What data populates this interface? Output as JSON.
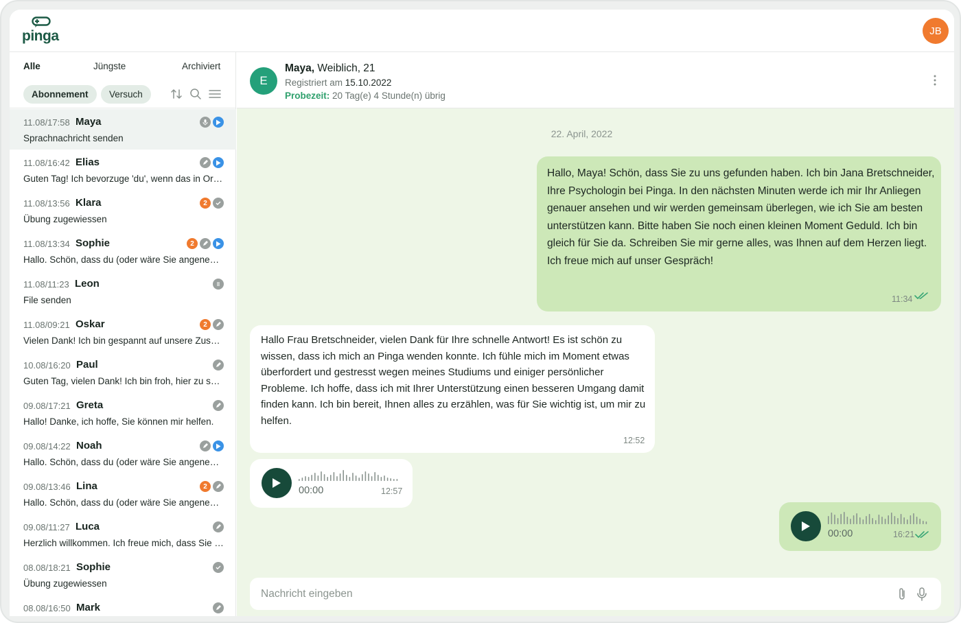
{
  "app": {
    "logo_text": "pinga",
    "user_initials": "JB"
  },
  "sidebar": {
    "tabs": [
      {
        "label": "Alle",
        "active": true
      },
      {
        "label": "Jüngste",
        "active": false
      },
      {
        "label": "Archiviert",
        "active": false
      }
    ],
    "filters": [
      {
        "label": "Abonnement",
        "selected": true
      },
      {
        "label": "Versuch",
        "selected": false
      }
    ],
    "filter_icons": [
      "sort-icon",
      "search-icon",
      "menu-icon"
    ],
    "conversations": [
      {
        "time": "11.08/17:58",
        "name": "Maya",
        "preview": "Sprachnachricht senden",
        "count": "",
        "icons": [
          "mic",
          "play"
        ],
        "selected": true
      },
      {
        "time": "11.08/16:42",
        "name": "Elias",
        "preview": "Guten Tag! Ich bevorzuge 'du', wenn das in Ordnung ist.",
        "count": "",
        "icons": [
          "pencil",
          "play"
        ],
        "selected": false
      },
      {
        "time": "11.08/13:56",
        "name": "Klara",
        "preview": "Übung zugewiessen",
        "count": "2",
        "icons": [
          "check"
        ],
        "selected": false
      },
      {
        "time": "11.08/13:34",
        "name": "Sophie",
        "preview": "Hallo. Schön, dass du (oder wäre Sie angenehmer?)",
        "count": "2",
        "icons": [
          "pencil",
          "play"
        ],
        "selected": false
      },
      {
        "time": "11.08/11:23",
        "name": "Leon",
        "preview": "File senden",
        "count": "",
        "icons": [
          "file"
        ],
        "selected": false
      },
      {
        "time": "11.08/09:21",
        "name": "Oskar",
        "preview": "Vielen Dank! Ich bin gespannt auf unsere Zusammenarbeit.",
        "count": "2",
        "icons": [
          "pencil"
        ],
        "selected": false
      },
      {
        "time": "10.08/16:20",
        "name": "Paul",
        "preview": "Guten Tag, vielen Dank! Ich bin froh, hier zu sein.",
        "count": "",
        "icons": [
          "pencil"
        ],
        "selected": false
      },
      {
        "time": "09.08/17:21",
        "name": "Greta",
        "preview": "Hallo! Danke, ich hoffe, Sie können mir helfen.",
        "count": "",
        "icons": [
          "pencil"
        ],
        "selected": false
      },
      {
        "time": "09.08/14:22",
        "name": "Noah",
        "preview": "Hallo. Schön, dass du (oder wäre Sie angenehmer?)",
        "count": "",
        "icons": [
          "pencil",
          "play"
        ],
        "selected": false
      },
      {
        "time": "09.08/13:46",
        "name": "Lina",
        "preview": "Hallo. Schön, dass du (oder wäre Sie angenehmer?)",
        "count": "2",
        "icons": [
          "pencil"
        ],
        "selected": false
      },
      {
        "time": "09.08/11:27",
        "name": "Luca",
        "preview": "Herzlich willkommen. Ich freue mich, dass Sie hier sind.",
        "count": "",
        "icons": [
          "pencil"
        ],
        "selected": false
      },
      {
        "time": "08.08/18:21",
        "name": "Sophie",
        "preview": "Übung zugewiessen",
        "count": "",
        "icons": [
          "check"
        ],
        "selected": false
      },
      {
        "time": "08.08/16:50",
        "name": "Mark",
        "preview": "",
        "count": "",
        "icons": [
          "pencil"
        ],
        "selected": false
      }
    ]
  },
  "chat": {
    "header": {
      "avatar_letter": "E",
      "name": "Maya,",
      "details": " Weiblich, 21",
      "registered_label": "Registriert am ",
      "registered_date": "15.10.2022",
      "trial_label": "Probezeit:",
      "trial_value": " 20 Tag(e) 4 Stunde(n) übrig"
    },
    "date_separator": "22. April, 2022",
    "messages": [
      {
        "direction": "out",
        "text": "Hallo, Maya! Schön, dass Sie zu uns gefunden haben. Ich bin Jana Bretschneider, Ihre Psychologin bei Pinga. In den nächsten Minuten werde ich mir Ihr Anliegen genauer ansehen und wir werden gemeinsam überlegen, wie ich Sie am besten unterstützen kann. Bitte haben Sie noch einen kleinen Moment Geduld. Ich bin gleich für Sie da. Schreiben Sie mir gerne alles, was Ihnen auf dem Herzen liegt. Ich freue mich auf unser Gespräch!",
        "time": "11:34"
      },
      {
        "direction": "in",
        "text": "Hallo Frau Bretschneider, vielen Dank für Ihre schnelle Antwort! Es ist schön zu wissen, dass ich mich an Pinga wenden konnte. Ich fühle mich im Moment etwas überfordert und gestresst wegen meines Studiums und einiger persönlicher Probleme. Ich hoffe, dass ich mit Ihrer Unterstützung einen besseren Umgang damit finden kann. Ich bin bereit, Ihnen alles zu erzählen, was für Sie wichtig ist, um mir zu helfen.",
        "time": "12:52"
      }
    ],
    "audio_in": {
      "position": "00:00",
      "time": "12:57"
    },
    "audio_out": {
      "position": "00:00",
      "time": "16:21"
    },
    "composer": {
      "placeholder": "Nachricht eingeben"
    }
  },
  "colors": {
    "brand": "#1c5a45",
    "accent_orange": "#f07a2e",
    "bubble_out": "#cde8b8",
    "chat_bg": "#eef6e7",
    "play_blue": "#3a92e6"
  }
}
